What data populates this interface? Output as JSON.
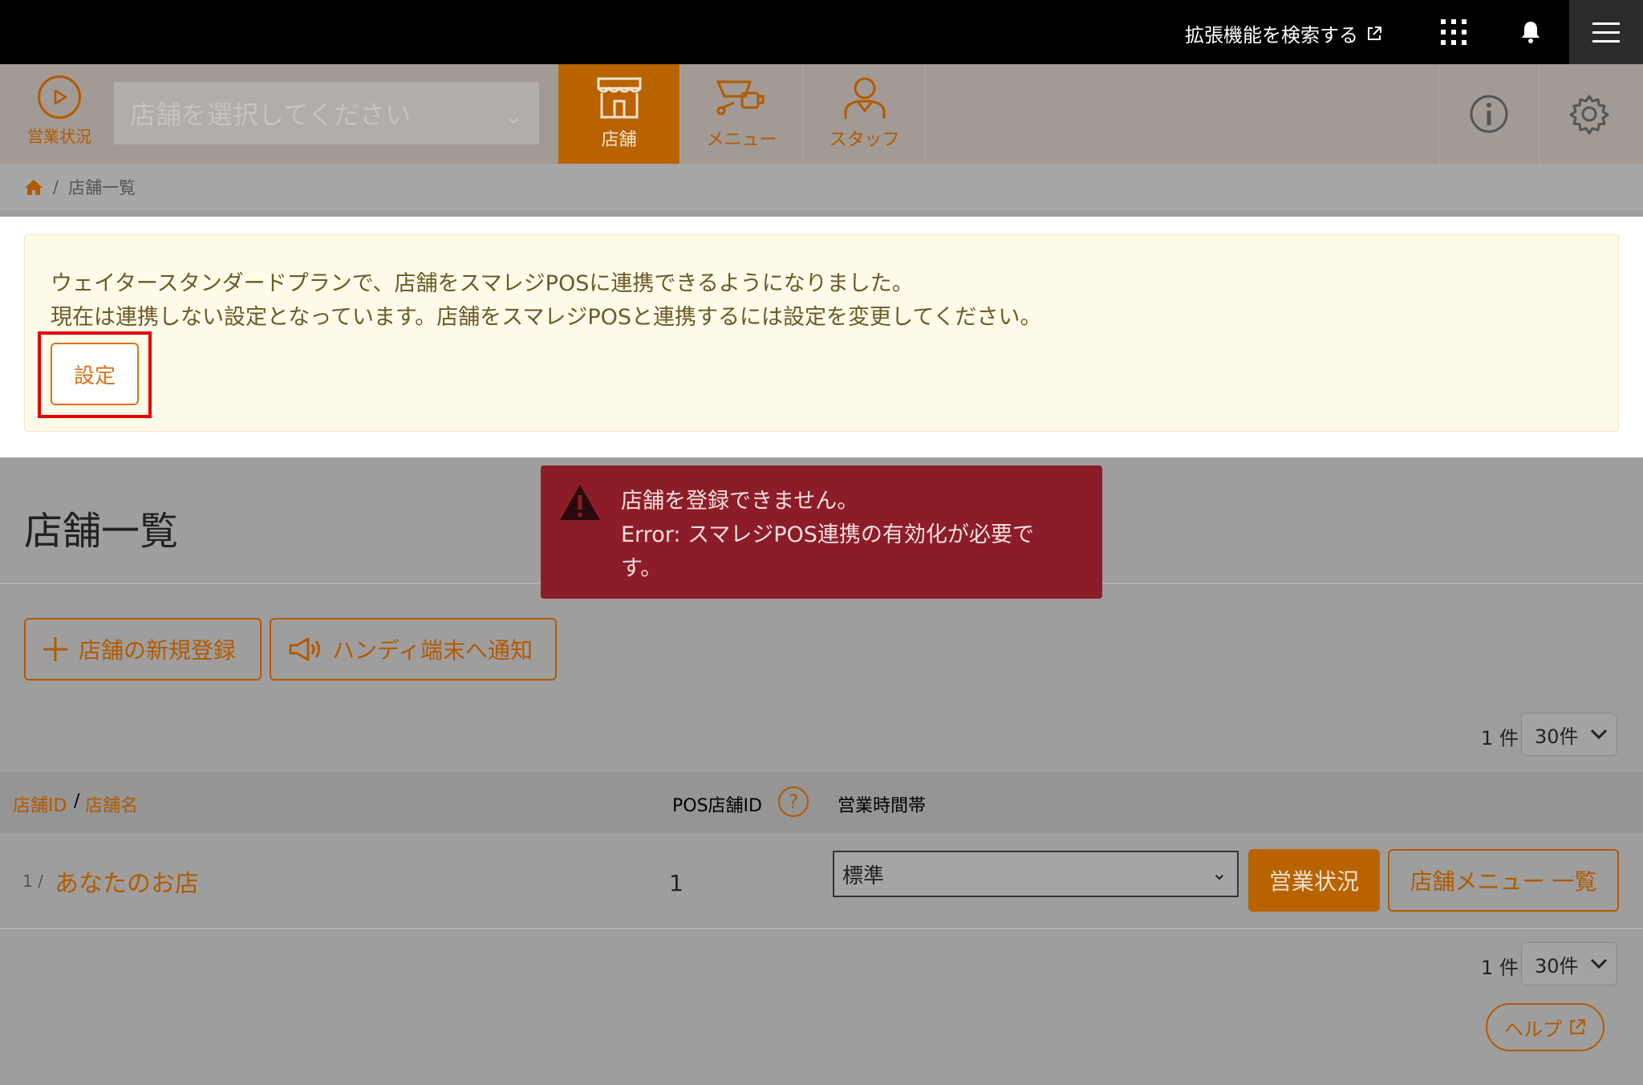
{
  "topbar": {
    "extension_link": "拡張機能を検索する",
    "icons": [
      "external-link-icon",
      "apps-grid-icon",
      "bell-icon",
      "hamburger-icon"
    ]
  },
  "nav": {
    "status_label": "営業状況",
    "store_select_placeholder": "店舗を選択してください",
    "tabs": [
      {
        "label": "店舗",
        "active": true,
        "icon": "store-icon"
      },
      {
        "label": "メニュー",
        "active": false,
        "icon": "menu-dish-icon"
      },
      {
        "label": "スタッフ",
        "active": false,
        "icon": "staff-icon"
      }
    ],
    "right_icons": [
      "info-icon",
      "gear-icon"
    ]
  },
  "breadcrumb": {
    "current": "店舗一覧"
  },
  "alert": {
    "line1": "ウェイタースタンダードプランで、店舗をスマレジPOSに連携できるようになりました。",
    "line2": "現在は連携しない設定となっています。店舗をスマレジPOSと連携するには設定を変更してください。",
    "button": "設定"
  },
  "toast": {
    "line1": "店舗を登録できません。",
    "line2": "Error: スマレジPOS連携の有効化が必要です。"
  },
  "page": {
    "title": "店舗一覧",
    "new_store_button": "店舗の新規登録",
    "notify_button": "ハンディ端末へ通知",
    "count_label": "1 件",
    "per_page": "30件"
  },
  "table": {
    "headers": {
      "id": "店舗ID",
      "sep": "/",
      "name": "店舗名",
      "pos_id": "POS店舗ID",
      "hours": "営業時間帯"
    },
    "rows": [
      {
        "id": "1 /",
        "name": "あなたのお店",
        "pos_id": "1",
        "hours": "標準",
        "status_button": "営業状況",
        "menu_button": "店舗メニュー 一覧"
      }
    ]
  },
  "footer": {
    "count_label": "1 件",
    "per_page": "30件",
    "help_button": "ヘルプ"
  },
  "colors": {
    "accent": "#b35a00",
    "error": "#8c1d28",
    "highlight": "#e60000"
  }
}
